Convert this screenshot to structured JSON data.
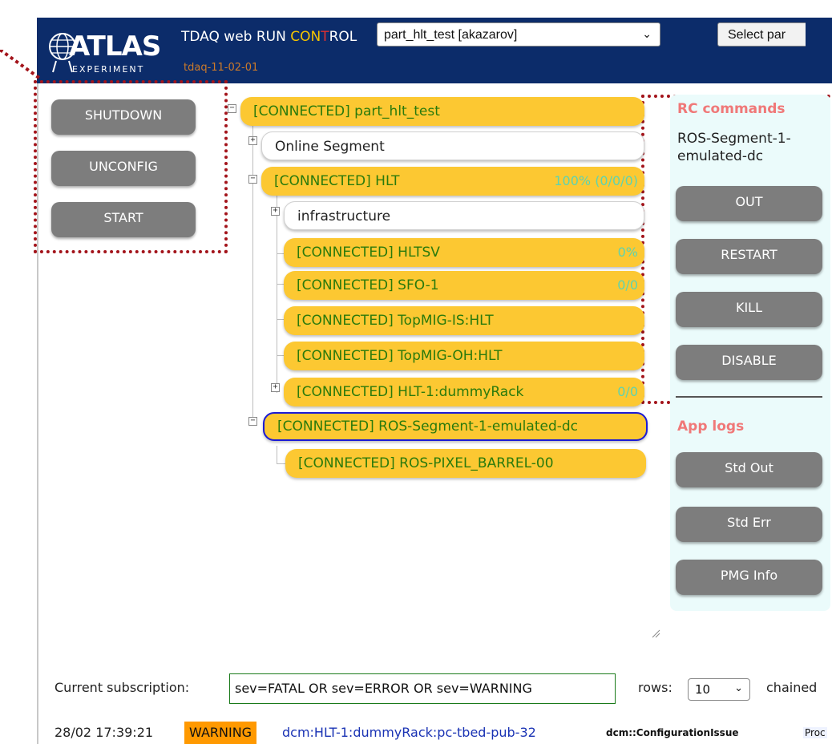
{
  "header": {
    "logo_text": "ATLAS",
    "logo_sub": "EXPERIMENT",
    "title_pre": "TDAQ web RUN ",
    "title_hl": "CON",
    "title_mid": "T",
    "title_post": "ROL",
    "version": "tdaq-11-02-01",
    "partition_value": "part_hlt_test [akazarov]",
    "select_button": "Select par",
    "chevron": "⌄"
  },
  "commands": {
    "shutdown": "SHUTDOWN",
    "unconfig": "UNCONFIG",
    "start": "START"
  },
  "tree": {
    "root": "[CONNECTED] part_hlt_test",
    "online_segment": "Online Segment",
    "hlt": "[CONNECTED] HLT",
    "hlt_pct": "100% (0/0/0)",
    "infrastructure": "infrastructure",
    "hltsv": "[CONNECTED] HLTSV",
    "hltsv_pct": "0%",
    "sfo": "[CONNECTED] SFO-1",
    "sfo_pct": "0/0",
    "topmig_is": "[CONNECTED] TopMIG-IS:HLT",
    "topmig_oh": "[CONNECTED] TopMIG-OH:HLT",
    "hlt1": "[CONNECTED] HLT-1:dummyRack",
    "hlt1_pct": "0/0",
    "ros_segment": "[CONNECTED] ROS-Segment-1-emulated-dc",
    "ros_pixel": "[CONNECTED] ROS-PIXEL_BARREL-00",
    "plus": "+",
    "minus": "−"
  },
  "panel": {
    "rc_heading": "RC commands",
    "selected": "ROS-Segment-1-emulated-dc",
    "out": "OUT",
    "restart": "RESTART",
    "kill": "KILL",
    "disable": "DISABLE",
    "logs_heading": "App logs",
    "std_out": "Std Out",
    "std_err": "Std Err",
    "pmg_info": "PMG Info"
  },
  "footer": {
    "subscription_label": "Current subscription:",
    "subscription_value": "sev=FATAL OR sev=ERROR OR sev=WARNING",
    "rows_label": "rows:",
    "rows_value": "10",
    "chained": "chained"
  },
  "log": {
    "time": "28/02 17:39:21",
    "severity": "WARNING",
    "app": "dcm:HLT-1:dummyRack:pc-tbed-pub-32",
    "msg_id": "dcm::ConfigurationIssue",
    "text": "Proc"
  },
  "colors": {
    "header_bg": "#0c2c6a",
    "connected": "#fcc832",
    "connected_text": "#2a7a0c",
    "highlight_dots": "#a3141b",
    "warning": "#ff9900",
    "selected_border": "#1b1bd6"
  },
  "icons": [
    "atlas-globe-icon",
    "chevron-down-icon",
    "expand-icon",
    "collapse-icon",
    "resize-grip-icon"
  ]
}
